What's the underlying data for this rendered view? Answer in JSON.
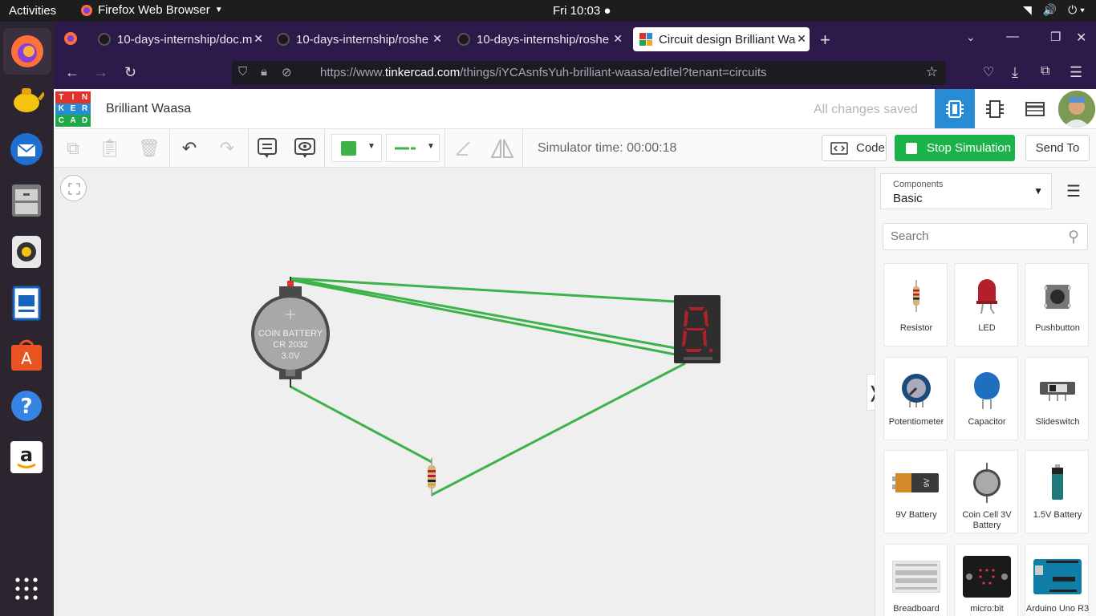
{
  "system": {
    "activities": "Activities",
    "browser_name": "Firefox Web Browser",
    "clock": "Fri 10:03 ●"
  },
  "tabs": [
    {
      "label": "10-days-internship/doc.m",
      "icon": "github-icon"
    },
    {
      "label": "10-days-internship/roshe",
      "icon": "github-icon"
    },
    {
      "label": "10-days-internship/roshe",
      "icon": "github-icon"
    },
    {
      "label": "Circuit design Brilliant Wa",
      "icon": "tinkercad-icon",
      "active": true
    }
  ],
  "url": {
    "prefix": "https://www.",
    "domain": "tinkercad.com",
    "path": "/things/iYCAsnfsYuh-brilliant-waasa/editel?tenant=circuits"
  },
  "app": {
    "logo_letters": [
      "TIN",
      "KER",
      "CAD"
    ],
    "title": "Brilliant Waasa",
    "save_status": "All changes saved"
  },
  "toolbar": {
    "sim_time": "Simulator time: 00:00:18",
    "code_label": "Code",
    "stop_label": "Stop Simulation",
    "send_label": "Send To",
    "wire_color": "#3cb34a"
  },
  "circuit": {
    "battery_text": [
      "COIN BATTERY",
      "CR 2032",
      "3.0V"
    ]
  },
  "panel": {
    "components_label": "Components",
    "components_value": "Basic",
    "search_placeholder": "Search",
    "items": [
      {
        "label": "Resistor",
        "icon": "resistor-icon"
      },
      {
        "label": "LED",
        "icon": "led-icon"
      },
      {
        "label": "Pushbutton",
        "icon": "pushbutton-icon"
      },
      {
        "label": "Potentiometer",
        "icon": "potentiometer-icon"
      },
      {
        "label": "Capacitor",
        "icon": "capacitor-icon"
      },
      {
        "label": "Slideswitch",
        "icon": "slideswitch-icon"
      },
      {
        "label": "9V Battery",
        "icon": "battery-9v-icon"
      },
      {
        "label": "Coin Cell 3V Battery",
        "icon": "coin-cell-icon"
      },
      {
        "label": "1.5V Battery",
        "icon": "battery-1-5v-icon"
      },
      {
        "label": "Breadboard",
        "icon": "breadboard-icon"
      },
      {
        "label": "micro:bit",
        "icon": "microbit-icon"
      },
      {
        "label": "Arduino Uno R3",
        "icon": "arduino-icon"
      }
    ]
  }
}
